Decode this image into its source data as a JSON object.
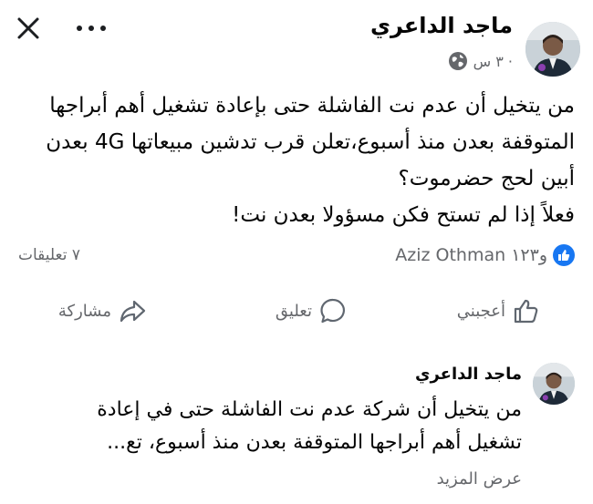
{
  "header": {
    "author_name": "ماجد الداعري",
    "timestamp": "٣ س ·",
    "close_icon": "close-icon",
    "more_icon": "more-options-icon",
    "privacy_icon": "globe-icon"
  },
  "post": {
    "text": "من يتخيل أن عدم نت الفاشلة حتى بإعادة تشغيل أهم أبراجها المتوقفة بعدن منذ أسبوع،تعلن قرب تدشين مبيعاتها 4G بعدن أبين لحج حضرموت؟\nفعلاً إذا لم تستح فكن مسؤولا بعدن نت!"
  },
  "reactions": {
    "summary": "Aziz Othman و١٢٣",
    "comments_count": "٧ تعليقات",
    "like_color": "#1877f2"
  },
  "actions": {
    "like": "أعجبني",
    "comment": "تعليق",
    "share": "مشاركة"
  },
  "comment": {
    "author": "ماجد الداعري",
    "text": "من يتخيل أن شركة عدم نت الفاشلة حتى في إعادة تشغيل أهم أبراجها المتوقفة بعدن منذ أسبوع، تع...",
    "see_more": "عرض المزيد"
  }
}
